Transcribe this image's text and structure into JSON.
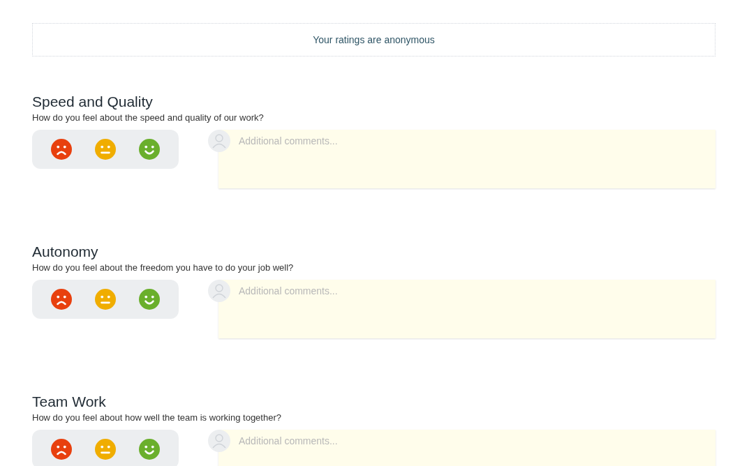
{
  "notice": "Your ratings are anonymous",
  "questions": [
    {
      "title": "Speed and Quality",
      "prompt": "How do you feel about the speed and quality of our work?",
      "comment": {
        "placeholder": "Additional comments..."
      }
    },
    {
      "title": "Autonomy",
      "prompt": "How do you feel about the freedom you have to do your job well?",
      "comment": {
        "placeholder": "Additional comments..."
      }
    },
    {
      "title": "Team Work",
      "prompt": "How do you feel about how well the team is working together?",
      "comment": {
        "placeholder": "Additional comments..."
      }
    }
  ]
}
